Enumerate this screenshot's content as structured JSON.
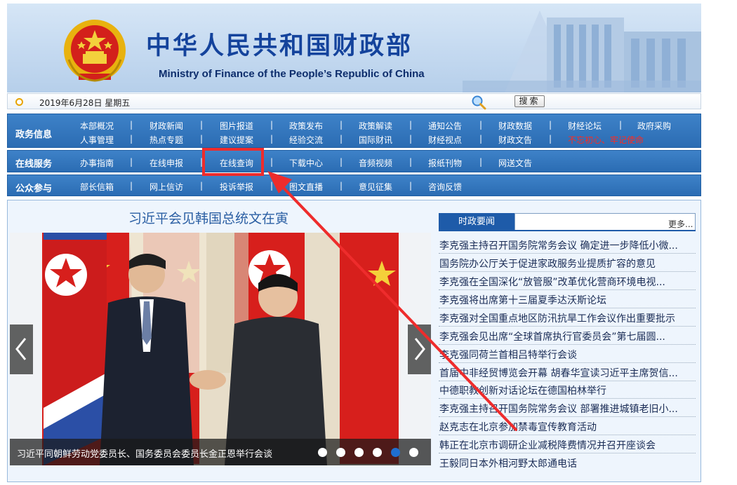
{
  "header": {
    "title": "中华人民共和国财政部",
    "subtitle": "Ministry of Finance of the People’s Republic of China"
  },
  "datebar": {
    "date": "2019年6月28日 星期五",
    "search_label": "搜索"
  },
  "nav": {
    "row1": {
      "heading": "政务信息",
      "top": [
        "本部概况",
        "财政新闻",
        "图片报道",
        "政策发布",
        "政策解读",
        "通知公告",
        "财政数据",
        "财经论坛",
        "政府采购"
      ],
      "bottom": [
        "人事管理",
        "热点专题",
        "建议提案",
        "经验交流",
        "国际财讯",
        "财经视点",
        "财政文告",
        "不忘初心、牢记使命"
      ]
    },
    "row2": {
      "heading": "在线服务",
      "items": [
        "办事指南",
        "在线申报",
        "在线查询",
        "下载中心",
        "音频视频",
        "报纸刊物",
        "网送文告"
      ]
    },
    "row3": {
      "heading": "公众参与",
      "items": [
        "部长信箱",
        "网上信访",
        "投诉举报",
        "图文直播",
        "意见征集",
        "咨询反馈"
      ]
    }
  },
  "featured": {
    "headline": "习近平会见韩国总统文在寅",
    "caption": "习近平同朝鲜劳动党委员长、国务委员会委员长金正恩举行会谈",
    "slides_total": 6,
    "active_slide": 5
  },
  "news": {
    "tab_label": "时政要闻",
    "more_label": "更多...",
    "items": [
      "李克强主持召开国务院常务会议 确定进一步降低小微...",
      "国务院办公厅关于促进家政服务业提质扩容的意见",
      "李克强在全国深化“放管服”改革优化营商环境电视...",
      "李克强将出席第十三届夏季达沃斯论坛",
      "李克强对全国重点地区防汛抗旱工作会议作出重要批示",
      "李克强会见出席“全球首席执行官委员会”第七届圆...",
      "李克强同荷兰首相吕特举行会谈",
      "首届中非经贸博览会开幕 胡春华宣读习近平主席贺信...",
      "中德职教创新对话论坛在德国柏林举行",
      "李克强主持召开国务院常务会议 部署推进城镇老旧小...",
      "赵克志在北京参加禁毒宣传教育活动",
      "韩正在北京市调研企业减税降费情况并召开座谈会",
      "王毅同日本外相河野太郎通电话"
    ]
  },
  "colors": {
    "nav_blue": "#2f73bb",
    "title_blue": "#14439c",
    "annotation_red": "#ee2c2c",
    "news_tab": "#1e5ba9"
  },
  "icons": [
    "national-emblem-icon",
    "search-icon",
    "chevron-left-icon",
    "chevron-right-icon",
    "date-bullet-icon"
  ]
}
